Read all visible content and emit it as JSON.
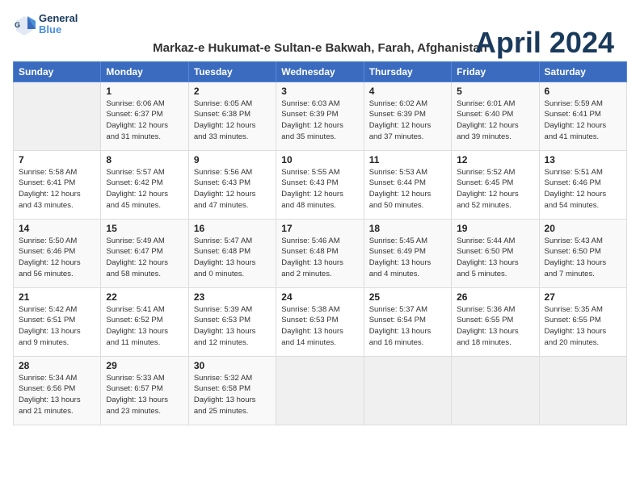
{
  "header": {
    "logo_line1": "General",
    "logo_line2": "Blue",
    "month": "April 2024",
    "location": "Markaz-e Hukumat-e Sultan-e Bakwah, Farah, Afghanistan"
  },
  "weekdays": [
    "Sunday",
    "Monday",
    "Tuesday",
    "Wednesday",
    "Thursday",
    "Friday",
    "Saturday"
  ],
  "weeks": [
    [
      {
        "day": "",
        "info": ""
      },
      {
        "day": "1",
        "info": "Sunrise: 6:06 AM\nSunset: 6:37 PM\nDaylight: 12 hours\nand 31 minutes."
      },
      {
        "day": "2",
        "info": "Sunrise: 6:05 AM\nSunset: 6:38 PM\nDaylight: 12 hours\nand 33 minutes."
      },
      {
        "day": "3",
        "info": "Sunrise: 6:03 AM\nSunset: 6:39 PM\nDaylight: 12 hours\nand 35 minutes."
      },
      {
        "day": "4",
        "info": "Sunrise: 6:02 AM\nSunset: 6:39 PM\nDaylight: 12 hours\nand 37 minutes."
      },
      {
        "day": "5",
        "info": "Sunrise: 6:01 AM\nSunset: 6:40 PM\nDaylight: 12 hours\nand 39 minutes."
      },
      {
        "day": "6",
        "info": "Sunrise: 5:59 AM\nSunset: 6:41 PM\nDaylight: 12 hours\nand 41 minutes."
      }
    ],
    [
      {
        "day": "7",
        "info": "Sunrise: 5:58 AM\nSunset: 6:41 PM\nDaylight: 12 hours\nand 43 minutes."
      },
      {
        "day": "8",
        "info": "Sunrise: 5:57 AM\nSunset: 6:42 PM\nDaylight: 12 hours\nand 45 minutes."
      },
      {
        "day": "9",
        "info": "Sunrise: 5:56 AM\nSunset: 6:43 PM\nDaylight: 12 hours\nand 47 minutes."
      },
      {
        "day": "10",
        "info": "Sunrise: 5:55 AM\nSunset: 6:43 PM\nDaylight: 12 hours\nand 48 minutes."
      },
      {
        "day": "11",
        "info": "Sunrise: 5:53 AM\nSunset: 6:44 PM\nDaylight: 12 hours\nand 50 minutes."
      },
      {
        "day": "12",
        "info": "Sunrise: 5:52 AM\nSunset: 6:45 PM\nDaylight: 12 hours\nand 52 minutes."
      },
      {
        "day": "13",
        "info": "Sunrise: 5:51 AM\nSunset: 6:46 PM\nDaylight: 12 hours\nand 54 minutes."
      }
    ],
    [
      {
        "day": "14",
        "info": "Sunrise: 5:50 AM\nSunset: 6:46 PM\nDaylight: 12 hours\nand 56 minutes."
      },
      {
        "day": "15",
        "info": "Sunrise: 5:49 AM\nSunset: 6:47 PM\nDaylight: 12 hours\nand 58 minutes."
      },
      {
        "day": "16",
        "info": "Sunrise: 5:47 AM\nSunset: 6:48 PM\nDaylight: 13 hours\nand 0 minutes."
      },
      {
        "day": "17",
        "info": "Sunrise: 5:46 AM\nSunset: 6:48 PM\nDaylight: 13 hours\nand 2 minutes."
      },
      {
        "day": "18",
        "info": "Sunrise: 5:45 AM\nSunset: 6:49 PM\nDaylight: 13 hours\nand 4 minutes."
      },
      {
        "day": "19",
        "info": "Sunrise: 5:44 AM\nSunset: 6:50 PM\nDaylight: 13 hours\nand 5 minutes."
      },
      {
        "day": "20",
        "info": "Sunrise: 5:43 AM\nSunset: 6:50 PM\nDaylight: 13 hours\nand 7 minutes."
      }
    ],
    [
      {
        "day": "21",
        "info": "Sunrise: 5:42 AM\nSunset: 6:51 PM\nDaylight: 13 hours\nand 9 minutes."
      },
      {
        "day": "22",
        "info": "Sunrise: 5:41 AM\nSunset: 6:52 PM\nDaylight: 13 hours\nand 11 minutes."
      },
      {
        "day": "23",
        "info": "Sunrise: 5:39 AM\nSunset: 6:53 PM\nDaylight: 13 hours\nand 12 minutes."
      },
      {
        "day": "24",
        "info": "Sunrise: 5:38 AM\nSunset: 6:53 PM\nDaylight: 13 hours\nand 14 minutes."
      },
      {
        "day": "25",
        "info": "Sunrise: 5:37 AM\nSunset: 6:54 PM\nDaylight: 13 hours\nand 16 minutes."
      },
      {
        "day": "26",
        "info": "Sunrise: 5:36 AM\nSunset: 6:55 PM\nDaylight: 13 hours\nand 18 minutes."
      },
      {
        "day": "27",
        "info": "Sunrise: 5:35 AM\nSunset: 6:55 PM\nDaylight: 13 hours\nand 20 minutes."
      }
    ],
    [
      {
        "day": "28",
        "info": "Sunrise: 5:34 AM\nSunset: 6:56 PM\nDaylight: 13 hours\nand 21 minutes."
      },
      {
        "day": "29",
        "info": "Sunrise: 5:33 AM\nSunset: 6:57 PM\nDaylight: 13 hours\nand 23 minutes."
      },
      {
        "day": "30",
        "info": "Sunrise: 5:32 AM\nSunset: 6:58 PM\nDaylight: 13 hours\nand 25 minutes."
      },
      {
        "day": "",
        "info": ""
      },
      {
        "day": "",
        "info": ""
      },
      {
        "day": "",
        "info": ""
      },
      {
        "day": "",
        "info": ""
      }
    ]
  ]
}
